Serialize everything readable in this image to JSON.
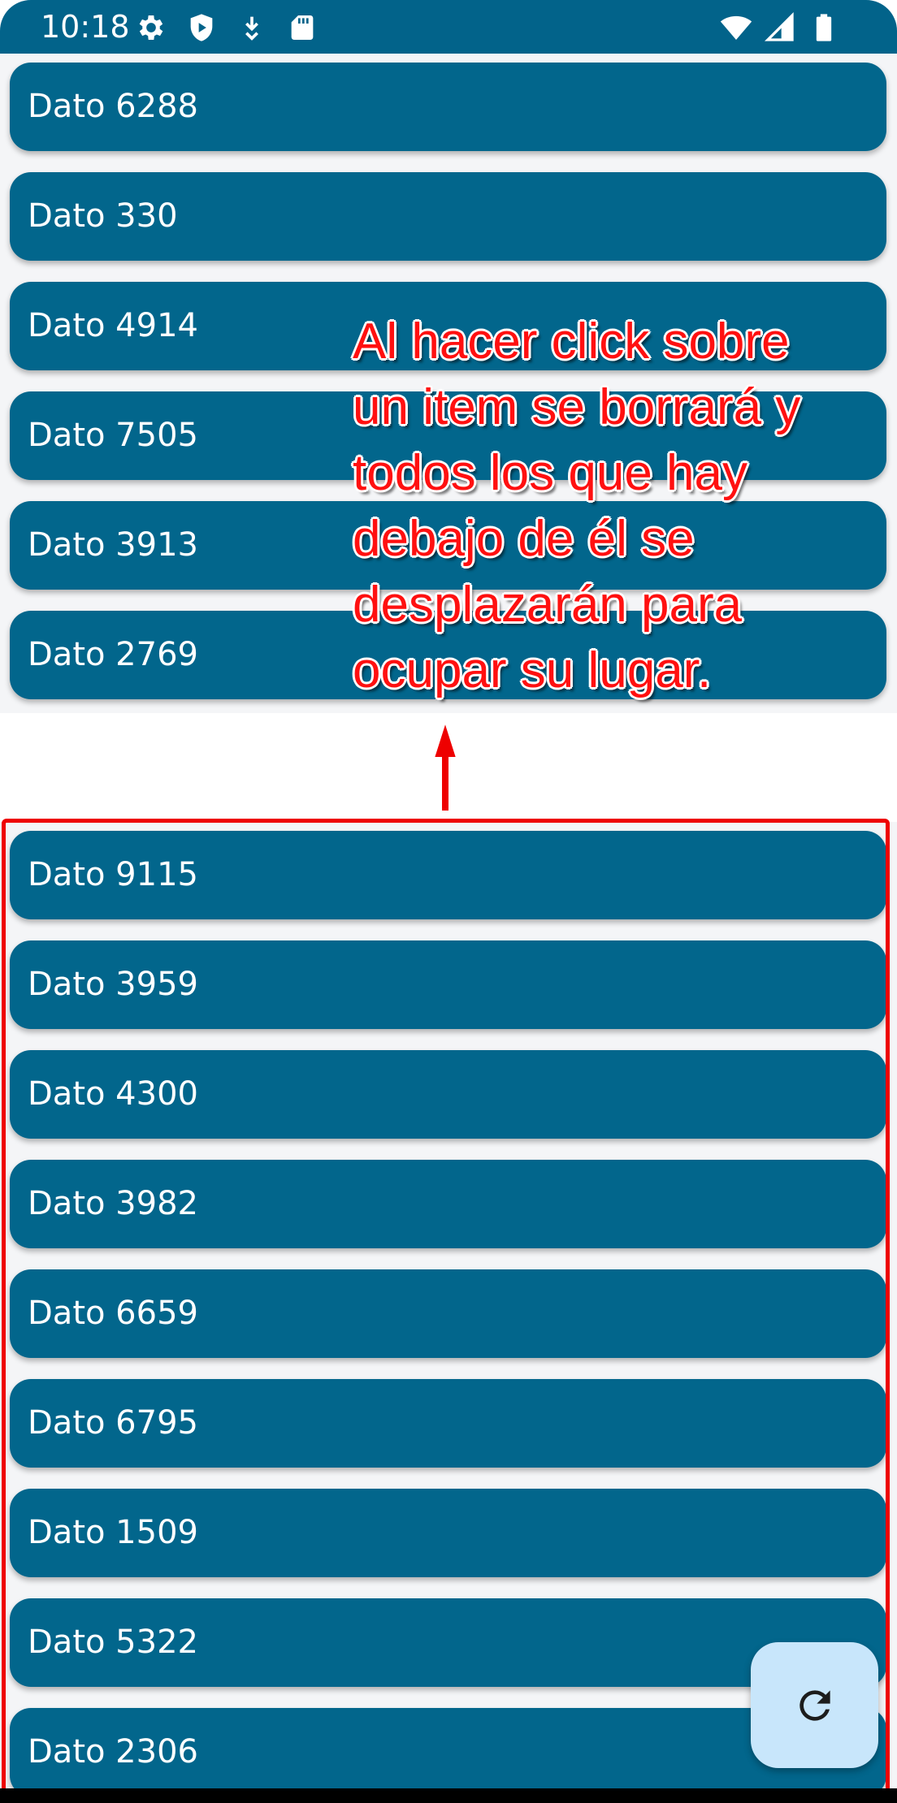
{
  "status_bar": {
    "time": "10:18",
    "left_icons": [
      "settings-icon",
      "shield-play-icon",
      "download-arrow-icon",
      "sd-card-icon"
    ],
    "right_icons": [
      "wifi-icon",
      "cell-signal-icon",
      "battery-icon"
    ]
  },
  "list_top": {
    "items": [
      {
        "label": "Dato 6288"
      },
      {
        "label": "Dato 330"
      },
      {
        "label": "Dato 4914"
      },
      {
        "label": "Dato 7505"
      },
      {
        "label": "Dato 3913"
      },
      {
        "label": "Dato 2769"
      }
    ]
  },
  "list_bottom": {
    "items": [
      {
        "label": "Dato 9115"
      },
      {
        "label": "Dato 3959"
      },
      {
        "label": "Dato 4300"
      },
      {
        "label": "Dato 3982"
      },
      {
        "label": "Dato 6659"
      },
      {
        "label": "Dato 6795"
      },
      {
        "label": "Dato 1509"
      },
      {
        "label": "Dato 5322"
      },
      {
        "label": "Dato 2306"
      }
    ]
  },
  "annotation": {
    "text": "Al hacer click sobre\nun item se borrará y\ntodos los que hay\ndebajo de él se\ndesplazarán para\nocupar su lugar.",
    "color": "#ff1010"
  },
  "fab": {
    "icon": "refresh-icon",
    "color": "#c8e6fb"
  },
  "colors": {
    "item_background": "#02668c",
    "status_bar": "#02638a",
    "highlight_border": "#ee0000"
  }
}
